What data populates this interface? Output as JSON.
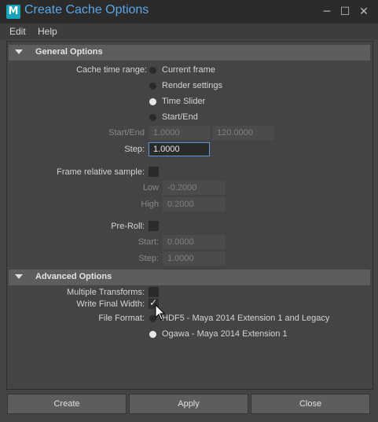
{
  "window": {
    "title": "Create Cache Options",
    "app_icon_letter": "M",
    "controls": [
      "─",
      "☐",
      "✕"
    ]
  },
  "menu": [
    "Edit",
    "Help"
  ],
  "general": {
    "header": "General Options",
    "cache_time_range_label": "Cache time range:",
    "range_options": [
      "Current frame",
      "Render settings",
      "Time Slider",
      "Start/End"
    ],
    "selected_range": "Time Slider",
    "start_end_label": "Start/End",
    "start_value": "1.0000",
    "end_value": "120.0000",
    "step_label": "Step:",
    "step_value": "1.0000",
    "frame_relative_label": "Frame relative sample:",
    "frame_relative_checked": false,
    "low_label": "Low",
    "low_value": "-0.2000",
    "high_label": "High",
    "high_value": "0.2000",
    "preroll_label": "Pre-Roll:",
    "preroll_checked": false,
    "preroll_start_label": "Start:",
    "preroll_start_value": "0.0000",
    "preroll_step_label": "Step:",
    "preroll_step_value": "1.0000"
  },
  "advanced": {
    "header": "Advanced Options",
    "multiple_transforms_label": "Multiple Transforms:",
    "multiple_transforms_checked": false,
    "write_final_width_label": "Write Final Width:",
    "write_final_width_checked": true,
    "file_format_label": "File Format:",
    "file_format_options": [
      "HDF5 - Maya 2014 Extension 1 and Legacy",
      "Ogawa - Maya 2014 Extension 1"
    ],
    "selected_file_format": "Ogawa - Maya 2014 Extension 1"
  },
  "buttons": {
    "create": "Create",
    "apply": "Apply",
    "close": "Close"
  }
}
